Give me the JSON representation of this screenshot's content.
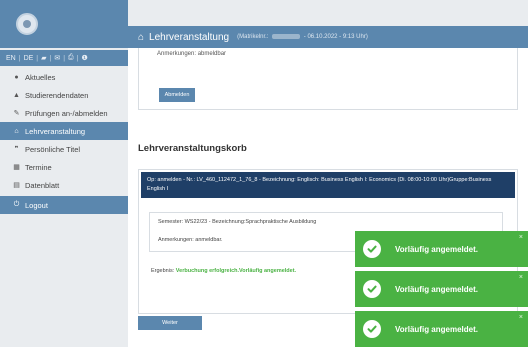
{
  "sidebar": {
    "lang_bar": {
      "en": "EN",
      "de": "DE"
    },
    "items": [
      {
        "label": "Aktuelles",
        "icon": "speech-bubble-icon"
      },
      {
        "label": "Studierendendaten",
        "icon": "graduation-cap-icon"
      },
      {
        "label": "Prüfungen an-/abmelden",
        "icon": "edit-icon"
      },
      {
        "label": "Lehrveranstaltung",
        "icon": "institution-icon",
        "active": true
      },
      {
        "label": "Persönliche Titel",
        "icon": "quote-icon"
      },
      {
        "label": "Termine",
        "icon": "calendar-icon"
      },
      {
        "label": "Datenblatt",
        "icon": "document-icon"
      },
      {
        "label": "Logout",
        "icon": "power-icon"
      }
    ]
  },
  "header": {
    "title": "Lehrveranstaltung",
    "matrikel_label": "(Matrikelnr.:",
    "datetime": "- 06.10.2022 - 9:13 Uhr)"
  },
  "upper_card": {
    "note": "Anmerkungen: abmeldbar",
    "button_label": "Abmelden"
  },
  "section_title": "Lehrveranstaltungskorb",
  "korb": {
    "header_text": "Op: anmelden - Nr.: LV_460_112472_1_76_8 - Bezeichnung: Englisch: Business English I: Economics (Di. 08:00-10:00 Uhr)Gruppe:Business English I",
    "semester": "Semester: WS22/23 - Bezeichnung:Sprachpraktische Ausbildung",
    "anmerkungen": "Anmerkungen: anmeldbar.",
    "ergebnis_label": "Ergebnis:",
    "ergebnis_value": "Verbuchung erfolgreich.Vorläufig angemeldet.",
    "weiter_label": "Weiter"
  },
  "toasts": [
    {
      "message": "Vorläufig angemeldet.",
      "close": "×"
    },
    {
      "message": "Vorläufig angemeldet.",
      "close": "×"
    },
    {
      "message": "Vorläufig angemeldet.",
      "close": "×"
    }
  ],
  "colors": {
    "primary": "#5b87ae",
    "dark_header": "#1f3f67",
    "success": "#4ab243"
  }
}
